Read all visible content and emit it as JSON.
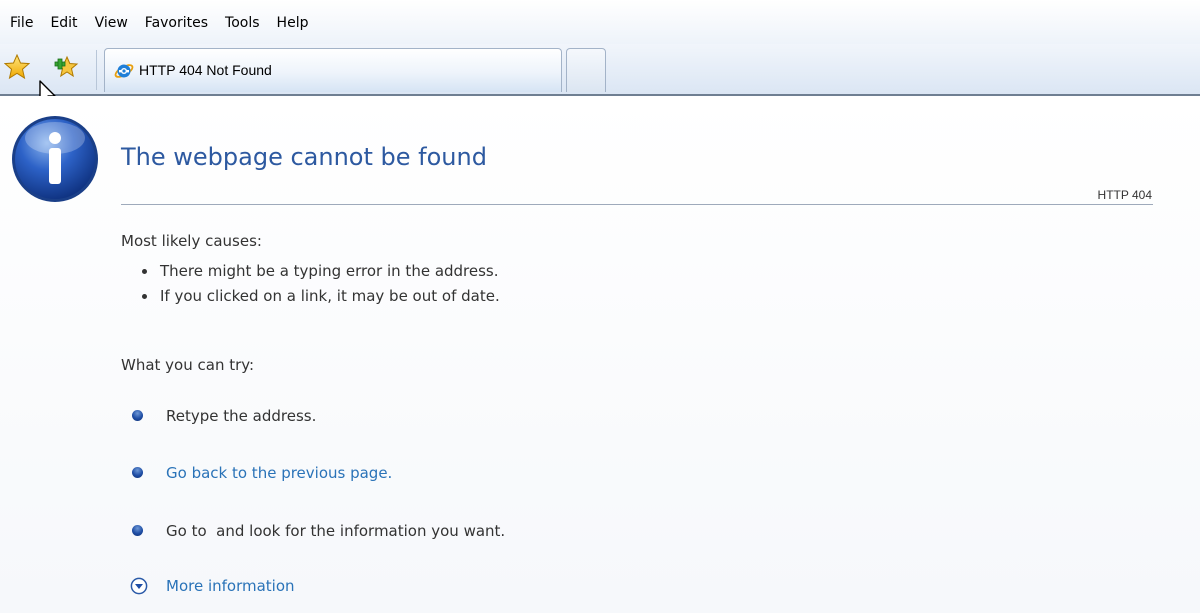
{
  "menu": {
    "items": [
      {
        "label": "File"
      },
      {
        "label": "Edit"
      },
      {
        "label": "View"
      },
      {
        "label": "Favorites"
      },
      {
        "label": "Tools"
      },
      {
        "label": "Help"
      }
    ]
  },
  "toolbar": {
    "favorites_icon": "favorites-star-icon",
    "add_favorites_icon": "add-to-favorites-icon"
  },
  "tab": {
    "title": "HTTP 404 Not Found",
    "icon": "internet-explorer-icon"
  },
  "page": {
    "title": "The webpage cannot be found",
    "http_code": "HTTP 404",
    "causes_heading": "Most likely causes:",
    "causes": [
      "There might be a typing error in the address.",
      "If you clicked on a link, it may be out of date."
    ],
    "try_heading": "What you can try:",
    "try_items": [
      {
        "text": "Retype the address."
      },
      {
        "text": "Go back to the previous page."
      },
      {
        "text": "Go to  and look for the information you want."
      }
    ],
    "more_info": "More information"
  },
  "colors": {
    "title": "#2d59a0",
    "link": "#2a73b8",
    "body_text": "#333333"
  }
}
